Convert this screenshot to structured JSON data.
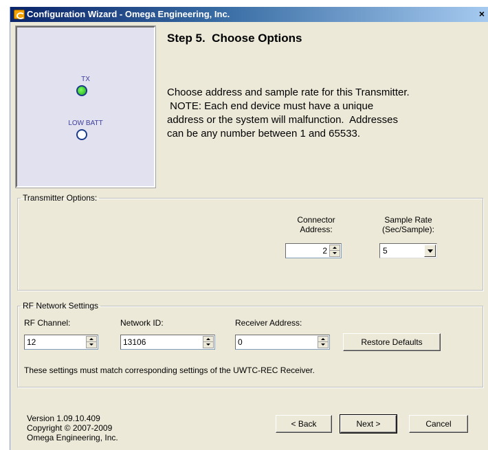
{
  "window": {
    "title": "Configuration Wizard - Omega Engineering, Inc.",
    "close_label": "×"
  },
  "leds": {
    "tx_label": "TX",
    "tx_state": "on",
    "low_batt_label": "LOW BATT",
    "low_batt_state": "off",
    "tx_color": "#3ec43e"
  },
  "step": {
    "title": "Step 5.  Choose Options",
    "description_lines": [
      "Choose address and sample rate for this Transmitter.",
      " NOTE: Each end device must have a unique",
      "address or the system will malfunction.  Addresses",
      "can be any number between 1 and 65533."
    ]
  },
  "transmitter_options": {
    "legend": "Transmitter Options:",
    "connector_address_label_1": "Connector",
    "connector_address_label_2": "Address:",
    "connector_address_value": "2",
    "sample_rate_label_1": "Sample Rate",
    "sample_rate_label_2": "(Sec/Sample):",
    "sample_rate_value": "5"
  },
  "rf_network": {
    "legend": "RF Network Settings",
    "rf_channel_label": "RF Channel:",
    "rf_channel_value": "12",
    "network_id_label": "Network ID:",
    "network_id_value": "13106",
    "receiver_address_label": "Receiver Address:",
    "receiver_address_value": "0",
    "restore_defaults_label": "Restore Defaults",
    "note": "These settings must match corresponding settings of the UWTC-REC Receiver."
  },
  "footer": {
    "version": "Version 1.09.10.409",
    "copyright": "Copyright © 2007-2009",
    "company": "Omega Engineering, Inc.",
    "back_label": "< Back",
    "next_label": "Next >",
    "cancel_label": "Cancel"
  }
}
